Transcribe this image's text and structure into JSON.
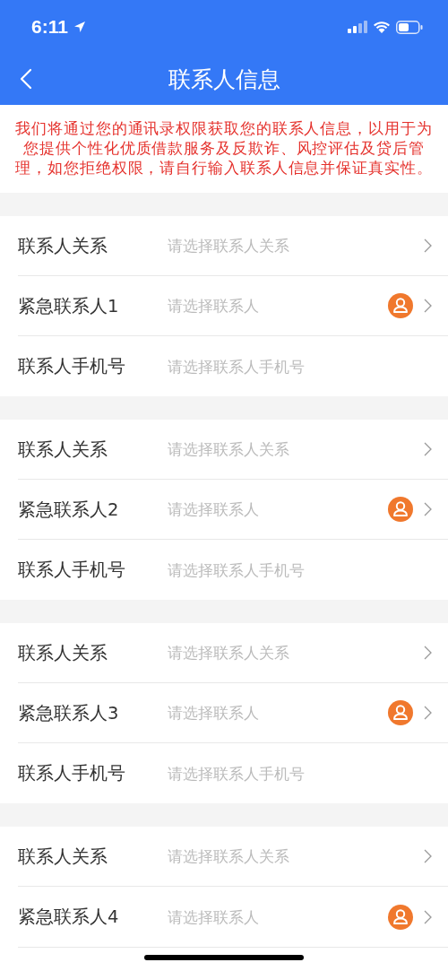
{
  "status_bar": {
    "time": "6:11"
  },
  "nav": {
    "title": "联系人信息"
  },
  "notice": "我们将通过您的通讯录权限获取您的联系人信息，以用于为您提供个性化优质借款服务及反欺诈、风控评估及贷后管理，如您拒绝权限，请自行输入联系人信息并保证真实性。",
  "groups": [
    {
      "fields": [
        {
          "kind": "select",
          "label": "联系人关系",
          "placeholder": "请选择联系人关系"
        },
        {
          "kind": "contact",
          "label": "紧急联系人1",
          "placeholder": "请选择联系人"
        },
        {
          "kind": "input",
          "label": "联系人手机号",
          "placeholder": "请选择联系人手机号"
        }
      ]
    },
    {
      "fields": [
        {
          "kind": "select",
          "label": "联系人关系",
          "placeholder": "请选择联系人关系"
        },
        {
          "kind": "contact",
          "label": "紧急联系人2",
          "placeholder": "请选择联系人"
        },
        {
          "kind": "input",
          "label": "联系人手机号",
          "placeholder": "请选择联系人手机号"
        }
      ]
    },
    {
      "fields": [
        {
          "kind": "select",
          "label": "联系人关系",
          "placeholder": "请选择联系人关系"
        },
        {
          "kind": "contact",
          "label": "紧急联系人3",
          "placeholder": "请选择联系人"
        },
        {
          "kind": "input",
          "label": "联系人手机号",
          "placeholder": "请选择联系人手机号"
        }
      ]
    },
    {
      "fields": [
        {
          "kind": "select",
          "label": "联系人关系",
          "placeholder": "请选择联系人关系"
        },
        {
          "kind": "contact",
          "label": "紧急联系人4",
          "placeholder": "请选择联系人"
        }
      ]
    }
  ]
}
